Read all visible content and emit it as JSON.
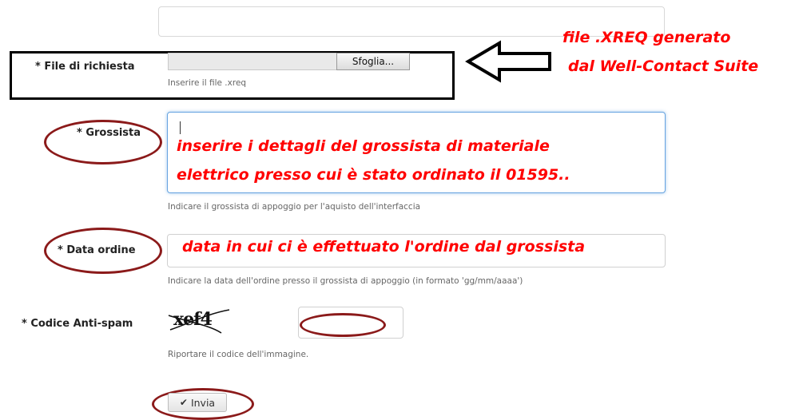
{
  "form": {
    "file_field": {
      "label": "* File di richiesta",
      "browse_label": "Sfoglia...",
      "help": "Inserire il file .xreq"
    },
    "grossista_field": {
      "label": "* Grossista",
      "help": "Indicare il grossista di appoggio per l'aquisto dell'interfaccia"
    },
    "data_field": {
      "label": "* Data ordine",
      "help": "Indicare la data dell'ordine presso il grossista di appoggio (in formato 'gg/mm/aaaa')"
    },
    "captcha_field": {
      "label": "* Codice Anti-spam",
      "captcha_text": "xef4",
      "help": "Riportare il codice dell'immagine."
    },
    "submit_label": "Invia"
  },
  "annotations": {
    "file_note_line1": "file   .XREQ  generato",
    "file_note_line2": "dal Well-Contact Suite",
    "grossista_note_line1": "inserire i dettagli del grossista di materiale",
    "grossista_note_line2": "elettrico presso cui è stato ordinato il   01595..",
    "data_note": "data in cui ci è effettuato l'ordine dal grossista"
  },
  "colors": {
    "annotation_red": "#ff0000",
    "ellipse_dark_red": "#8b1a1a",
    "focus_blue": "#66a3e0"
  }
}
